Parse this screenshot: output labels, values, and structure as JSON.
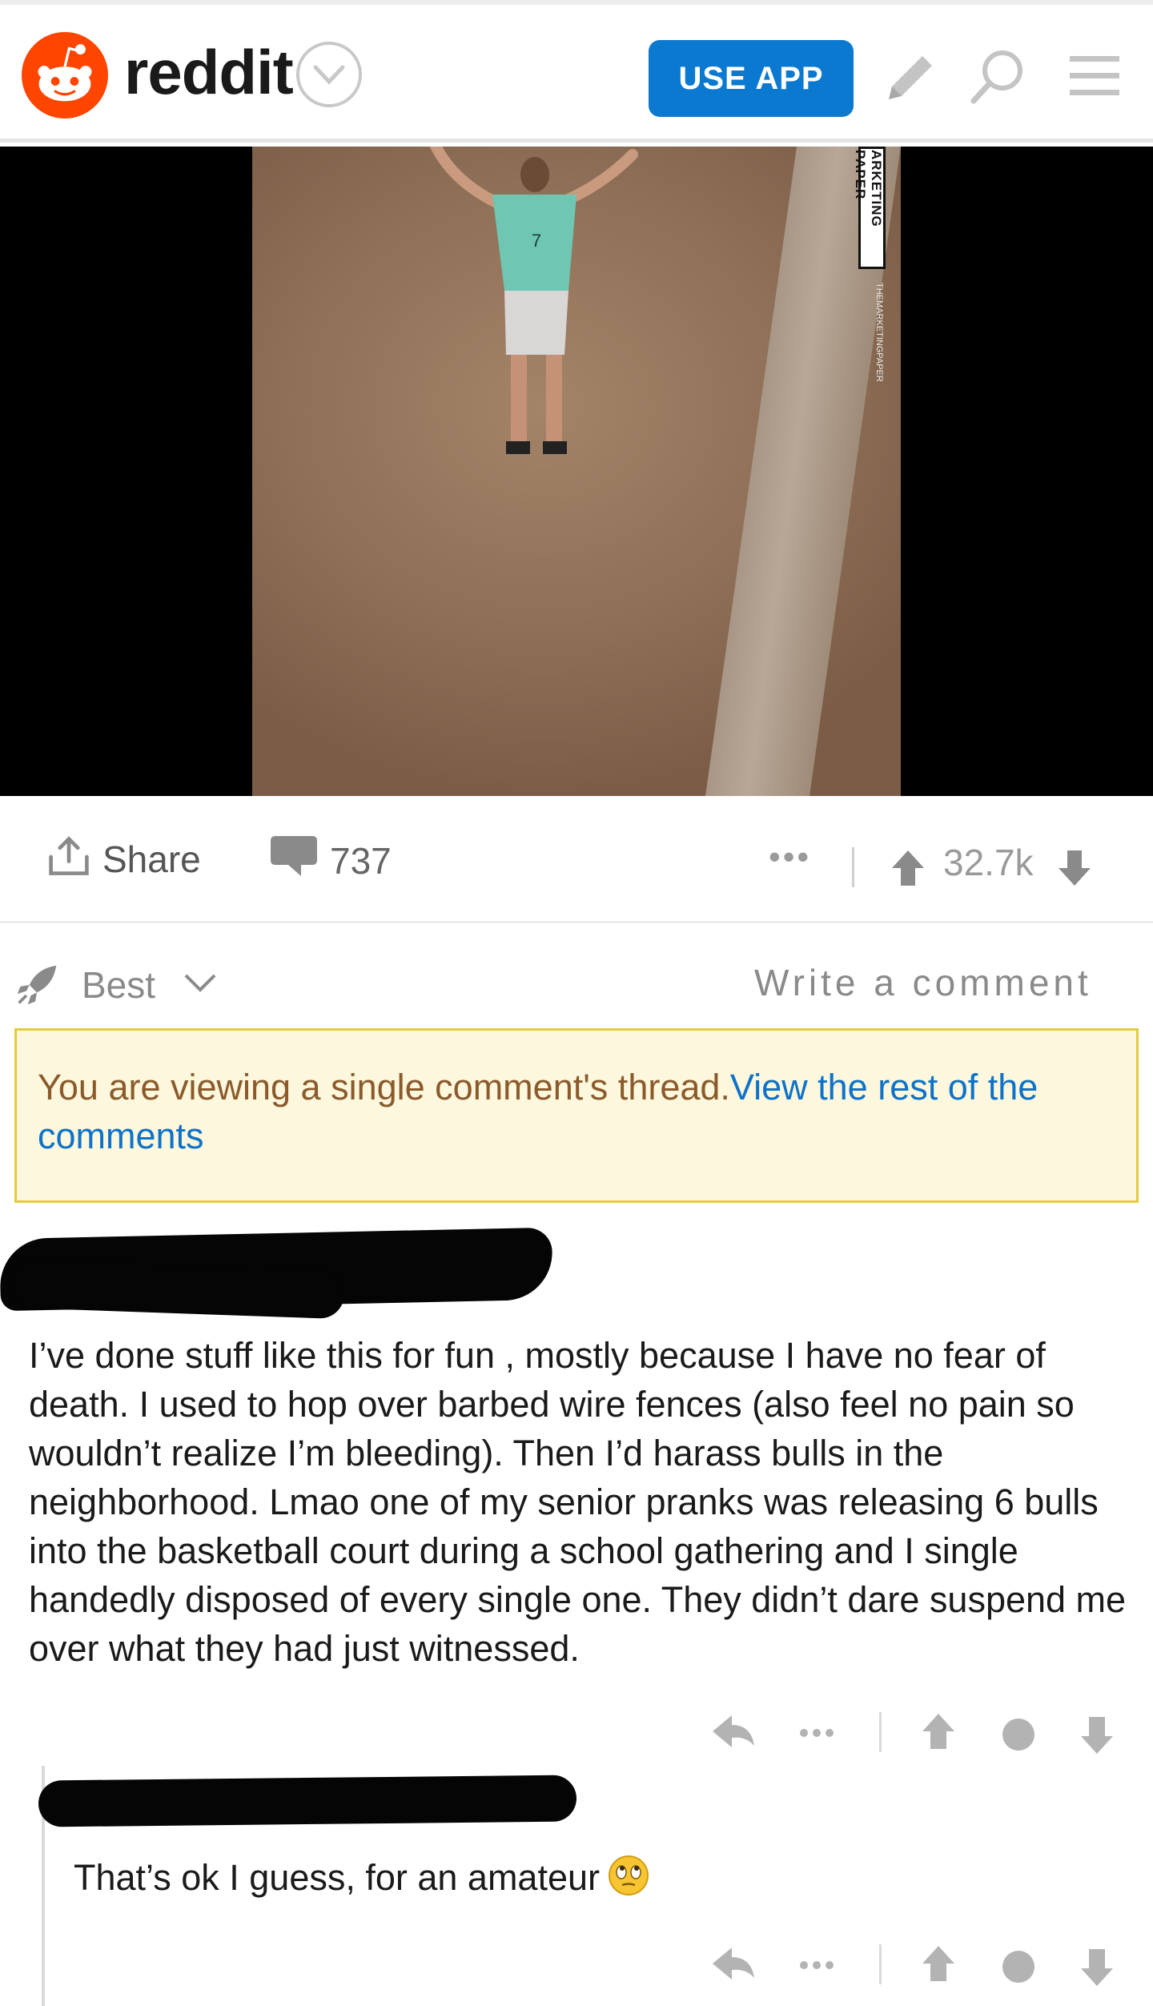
{
  "header": {
    "wordmark": "reddit",
    "use_app_label": "USE APP"
  },
  "media": {
    "watermark": "ARKETING PAPER",
    "watermark_handle": "THEMARKETINGPAPER",
    "jersey_number": "7"
  },
  "actions": {
    "share_label": "Share",
    "comment_count": "737",
    "more": "•••",
    "score": "32.7k"
  },
  "sort": {
    "label": "Best",
    "write_comment": "Write a comment"
  },
  "notice": {
    "text": "You are viewing a single comment's thread.",
    "link": "View the rest of the comments"
  },
  "comments": [
    {
      "body": "I’ve done stuff like this for fun , mostly because I have no fear of death. I used to hop over barbed wire fences (also feel no pain so wouldn’t realize I’m bleeding). Then I’d harass bulls in the neighborhood. Lmao one of my senior pranks was releasing 6 bulls into the basketball court during a school gathering and I single handedly disposed of every single one. They didn’t dare suspend me over what they had just witnessed."
    },
    {
      "body": "That’s ok I guess, for an amateur",
      "emoji": "face-with-rolling-eyes"
    }
  ],
  "colors": {
    "reddit_orange": "#ff4500",
    "use_app_blue": "#0b79d0",
    "link_blue": "#0d72c9",
    "notice_bg": "#fdf7dd",
    "notice_border": "#e3cc3b",
    "notice_text": "#8a5a2b"
  },
  "icons": [
    "reddit-snoo-icon",
    "chevron-down-icon",
    "pencil-icon",
    "search-icon",
    "menu-icon",
    "share-icon",
    "comment-icon",
    "upvote-icon",
    "downvote-icon",
    "rocket-icon",
    "reply-icon",
    "dot-icon",
    "emoji-icon"
  ]
}
